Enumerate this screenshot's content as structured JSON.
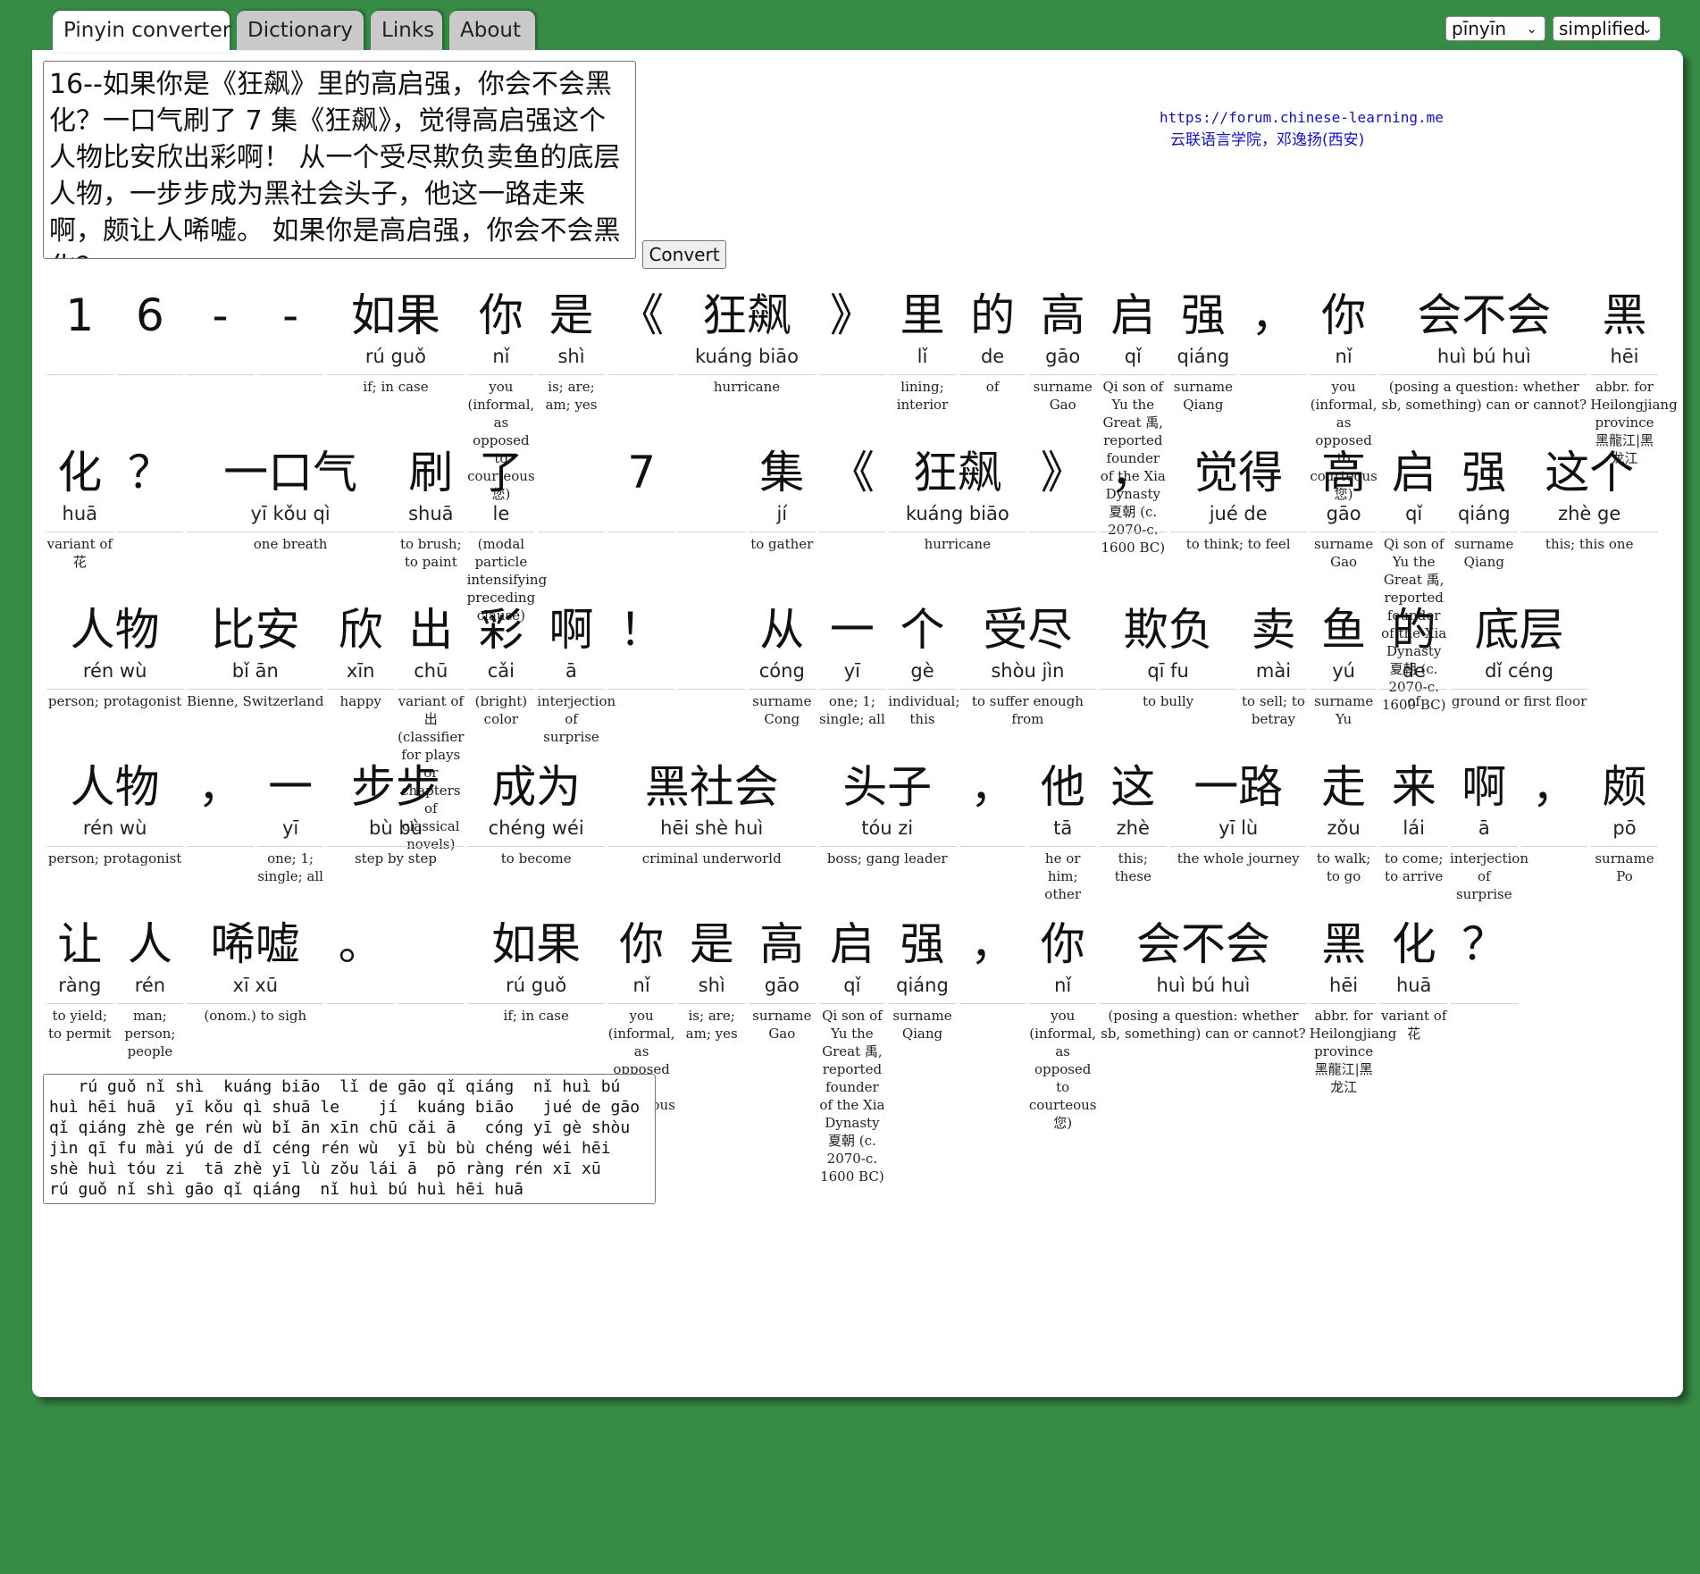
{
  "tabs": [
    "Pinyin converter",
    "Dictionary",
    "Links",
    "About"
  ],
  "selects": {
    "mode": "pīnyīn",
    "script": "simplified"
  },
  "input_text": "16--如果你是《狂飙》里的高启强，你会不会黑化？一口气刷了 7 集《狂飙》，觉得高启强这个人物比安欣出彩啊！ 从一个受尽欺负卖鱼的底层人物，一步步成为黑社会头子，他这一路走来啊，颇让人唏嘘。 如果你是高启强，你会不会黑化？",
  "convert_label": "Convert",
  "forum_link": "https://forum.chinese-learning.me",
  "school": "云联语言学院，邓逸扬(西安)",
  "rows": [
    [
      {
        "h": "1",
        "p": "",
        "g": ""
      },
      {
        "h": "6",
        "p": "",
        "g": ""
      },
      {
        "h": "-",
        "p": "",
        "g": ""
      },
      {
        "h": "-",
        "p": "",
        "g": ""
      },
      {
        "h": "如果",
        "p": "rú  guǒ",
        "g": "if; in case"
      },
      {
        "h": "你",
        "p": "nǐ",
        "g": "you (informal, as opposed to courteous 您)"
      },
      {
        "h": "是",
        "p": "shì",
        "g": "is; are; am; yes"
      },
      {
        "h": "《",
        "p": "",
        "g": ""
      },
      {
        "h": "狂飙",
        "p": "kuáng  biāo",
        "g": "hurricane"
      },
      {
        "h": "》",
        "p": "",
        "g": ""
      },
      {
        "h": "里",
        "p": "lǐ",
        "g": "lining; interior"
      },
      {
        "h": "的",
        "p": "de",
        "g": "of"
      },
      {
        "h": "高",
        "p": "gāo",
        "g": "surname Gao"
      },
      {
        "h": "启",
        "p": "qǐ",
        "g": "Qi son of Yu the Great 禹, reported founder of the Xia Dynasty 夏朝 (c. 2070-c. 1600 BC)"
      },
      {
        "h": "强",
        "p": "qiáng",
        "g": "surname Qiang"
      },
      {
        "h": "，",
        "p": "",
        "g": ""
      },
      {
        "h": "你",
        "p": "nǐ",
        "g": "you (informal, as opposed to courteous 您)"
      },
      {
        "h": "会不会",
        "p": "huì  bú  huì",
        "g": "(posing a question: whether sb, something) can or cannot?"
      },
      {
        "h": "黑",
        "p": "hēi",
        "g": "abbr. for Heilongjiang province 黑龍江|黑龙江"
      }
    ],
    [
      {
        "h": "化",
        "p": "huā",
        "g": "variant of 花"
      },
      {
        "h": "？",
        "p": "",
        "g": ""
      },
      {
        "h": "一口气",
        "p": "yī  kǒu  qì",
        "g": "one breath"
      },
      {
        "h": "刷",
        "p": "shuā",
        "g": "to brush; to paint"
      },
      {
        "h": "了",
        "p": "le",
        "g": "(modal particle intensifying preceding clause)"
      },
      {
        "h": "",
        "p": "",
        "g": ""
      },
      {
        "h": "7",
        "p": "",
        "g": ""
      },
      {
        "h": "",
        "p": "",
        "g": ""
      },
      {
        "h": "集",
        "p": "jí",
        "g": "to gather"
      },
      {
        "h": "《",
        "p": "",
        "g": ""
      },
      {
        "h": "狂飙",
        "p": "kuáng  biāo",
        "g": "hurricane"
      },
      {
        "h": "》",
        "p": "",
        "g": ""
      },
      {
        "h": "，",
        "p": "",
        "g": ""
      },
      {
        "h": "觉得",
        "p": "jué  de",
        "g": "to think; to feel"
      },
      {
        "h": "高",
        "p": "gāo",
        "g": "surname Gao"
      },
      {
        "h": "启",
        "p": "qǐ",
        "g": "Qi son of Yu the Great 禹, reported founder of the Xia Dynasty 夏朝 (c. 2070-c. 1600 BC)"
      },
      {
        "h": "强",
        "p": "qiáng",
        "g": "surname Qiang"
      },
      {
        "h": "这个",
        "p": "zhè  ge",
        "g": "this; this one"
      }
    ],
    [
      {
        "h": "人物",
        "p": "rén  wù",
        "g": "person; protagonist"
      },
      {
        "h": "比安",
        "p": "bǐ  ān",
        "g": "Bienne, Switzerland"
      },
      {
        "h": "欣",
        "p": "xīn",
        "g": "happy"
      },
      {
        "h": "出",
        "p": "chū",
        "g": "variant of 出 (classifier for plays or chapters of classical novels)"
      },
      {
        "h": "彩",
        "p": "cǎi",
        "g": "(bright) color"
      },
      {
        "h": "啊",
        "p": "ā",
        "g": "interjection of surprise"
      },
      {
        "h": "！",
        "p": "",
        "g": ""
      },
      {
        "h": "",
        "p": "",
        "g": ""
      },
      {
        "h": "从",
        "p": "cóng",
        "g": "surname Cong"
      },
      {
        "h": "一",
        "p": "yī",
        "g": "one; 1; single; all"
      },
      {
        "h": "个",
        "p": "gè",
        "g": "individual; this"
      },
      {
        "h": "受尽",
        "p": "shòu  jìn",
        "g": "to suffer enough from"
      },
      {
        "h": "欺负",
        "p": "qī  fu",
        "g": "to bully"
      },
      {
        "h": "卖",
        "p": "mài",
        "g": "to sell; to betray"
      },
      {
        "h": "鱼",
        "p": "yú",
        "g": "surname Yu"
      },
      {
        "h": "的",
        "p": "de",
        "g": "of"
      },
      {
        "h": "底层",
        "p": "dǐ  céng",
        "g": "ground or first floor"
      }
    ],
    [
      {
        "h": "人物",
        "p": "rén  wù",
        "g": "person; protagonist"
      },
      {
        "h": "，",
        "p": "",
        "g": ""
      },
      {
        "h": "一",
        "p": "yī",
        "g": "one; 1; single; all"
      },
      {
        "h": "步步",
        "p": "bù  bù",
        "g": "step by step"
      },
      {
        "h": "成为",
        "p": "chéng  wéi",
        "g": "to become"
      },
      {
        "h": "黑社会",
        "p": "hēi  shè  huì",
        "g": "criminal underworld"
      },
      {
        "h": "头子",
        "p": "tóu  zi",
        "g": "boss; gang leader"
      },
      {
        "h": "，",
        "p": "",
        "g": ""
      },
      {
        "h": "他",
        "p": "tā",
        "g": "he or him; other"
      },
      {
        "h": "这",
        "p": "zhè",
        "g": "this; these"
      },
      {
        "h": "一路",
        "p": "yī  lù",
        "g": "the whole journey"
      },
      {
        "h": "走",
        "p": "zǒu",
        "g": "to walk; to go"
      },
      {
        "h": "来",
        "p": "lái",
        "g": "to come; to arrive"
      },
      {
        "h": "啊",
        "p": "ā",
        "g": "interjection of surprise"
      },
      {
        "h": "，",
        "p": "",
        "g": ""
      },
      {
        "h": "颇",
        "p": "pō",
        "g": "surname Po"
      }
    ],
    [
      {
        "h": "让",
        "p": "ràng",
        "g": "to yield; to permit"
      },
      {
        "h": "人",
        "p": "rén",
        "g": "man; person; people"
      },
      {
        "h": "唏嘘",
        "p": "xī  xū",
        "g": "(onom.) to sigh"
      },
      {
        "h": "。",
        "p": "",
        "g": ""
      },
      {
        "h": "",
        "p": "",
        "g": ""
      },
      {
        "h": "如果",
        "p": "rú  guǒ",
        "g": "if; in case"
      },
      {
        "h": "你",
        "p": "nǐ",
        "g": "you (informal, as opposed to courteous 您)"
      },
      {
        "h": "是",
        "p": "shì",
        "g": "is; are; am; yes"
      },
      {
        "h": "高",
        "p": "gāo",
        "g": "surname Gao"
      },
      {
        "h": "启",
        "p": "qǐ",
        "g": "Qi son of Yu the Great 禹, reported founder of the Xia Dynasty 夏朝 (c. 2070-c. 1600 BC)"
      },
      {
        "h": "强",
        "p": "qiáng",
        "g": "surname Qiang"
      },
      {
        "h": "，",
        "p": "",
        "g": ""
      },
      {
        "h": "你",
        "p": "nǐ",
        "g": "you (informal, as opposed to courteous 您)"
      },
      {
        "h": "会不会",
        "p": "huì  bú  huì",
        "g": "(posing a question: whether sb, something) can or cannot?"
      },
      {
        "h": "黑",
        "p": "hēi",
        "g": "abbr. for Heilongjiang province 黑龍江|黑龙江"
      },
      {
        "h": "化",
        "p": "huā",
        "g": "variant of 花"
      },
      {
        "h": "？",
        "p": "",
        "g": ""
      }
    ]
  ],
  "output_text": "   rú guǒ nǐ shì  kuáng biāo  lǐ de gāo qǐ qiáng  nǐ huì bú\nhuì hēi huā  yī kǒu qì shuā le    jí  kuáng biāo   jué de gāo\nqǐ qiáng zhè ge rén wù bǐ ān xīn chū cǎi ā   cóng yī gè shòu\njìn qī fu mài yú de dǐ céng rén wù  yī bù bù chéng wéi hēi\nshè huì tóu zi  tā zhè yī lù zǒu lái ā  pō ràng rén xī xū\nrú guǒ nǐ shì gāo qǐ qiáng  nǐ huì bú huì hēi huā"
}
